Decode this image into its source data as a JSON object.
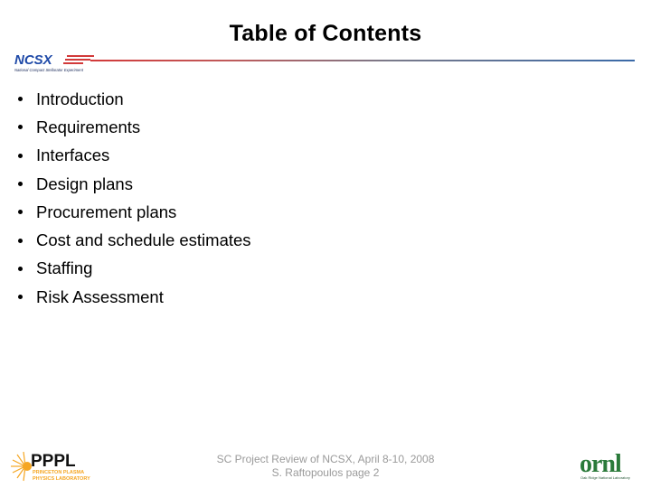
{
  "slide": {
    "title": "Table of Contents",
    "bullets": [
      "Introduction",
      "Requirements",
      "Interfaces",
      "Design plans",
      "Procurement plans",
      "Cost and schedule estimates",
      "Staffing",
      "Risk Assessment"
    ]
  },
  "header": {
    "logo": {
      "icon": "ncsx-logo",
      "text": "NCSX",
      "subtitle": "National Compact Stellarator Experiment",
      "color": "#1f4aa8"
    },
    "rule_colors": [
      "#d23a3a",
      "#3a6aa8"
    ]
  },
  "footer": {
    "line1": "SC Project Review of NCSX, April 8-10, 2008",
    "line2": "S. Raftopoulos page 2",
    "left_logo": {
      "icon": "pppl-logo",
      "text": "PPPL",
      "subtitle_line1": "PRINCETON PLASMA",
      "subtitle_line2": "PHYSICS LABORATORY",
      "accent": "#f5a623"
    },
    "right_logo": {
      "icon": "ornl-logo",
      "text": "ornl",
      "subtitle": "Oak Ridge National Laboratory",
      "color": "#2a7a3a"
    }
  }
}
